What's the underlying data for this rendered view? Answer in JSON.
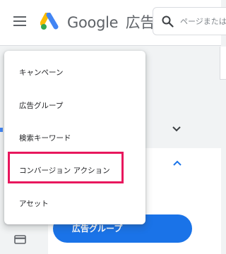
{
  "header": {
    "logo_brand": "Google",
    "logo_product": "広告",
    "search_placeholder": "ページまたは"
  },
  "menu": {
    "items": [
      {
        "label": "キャンペーン"
      },
      {
        "label": "広告グループ"
      },
      {
        "label": "検索キーワード"
      },
      {
        "label": "コンバージョン アクション"
      },
      {
        "label": "アセット"
      }
    ],
    "highlighted_index": 3
  },
  "main": {
    "primary_button_label": "広告グループ"
  },
  "colors": {
    "accent": "#1a73e8",
    "highlight": "#e8175d",
    "logo_blue": "#4285f4",
    "logo_yellow": "#fbbc04",
    "logo_green": "#34a853"
  }
}
